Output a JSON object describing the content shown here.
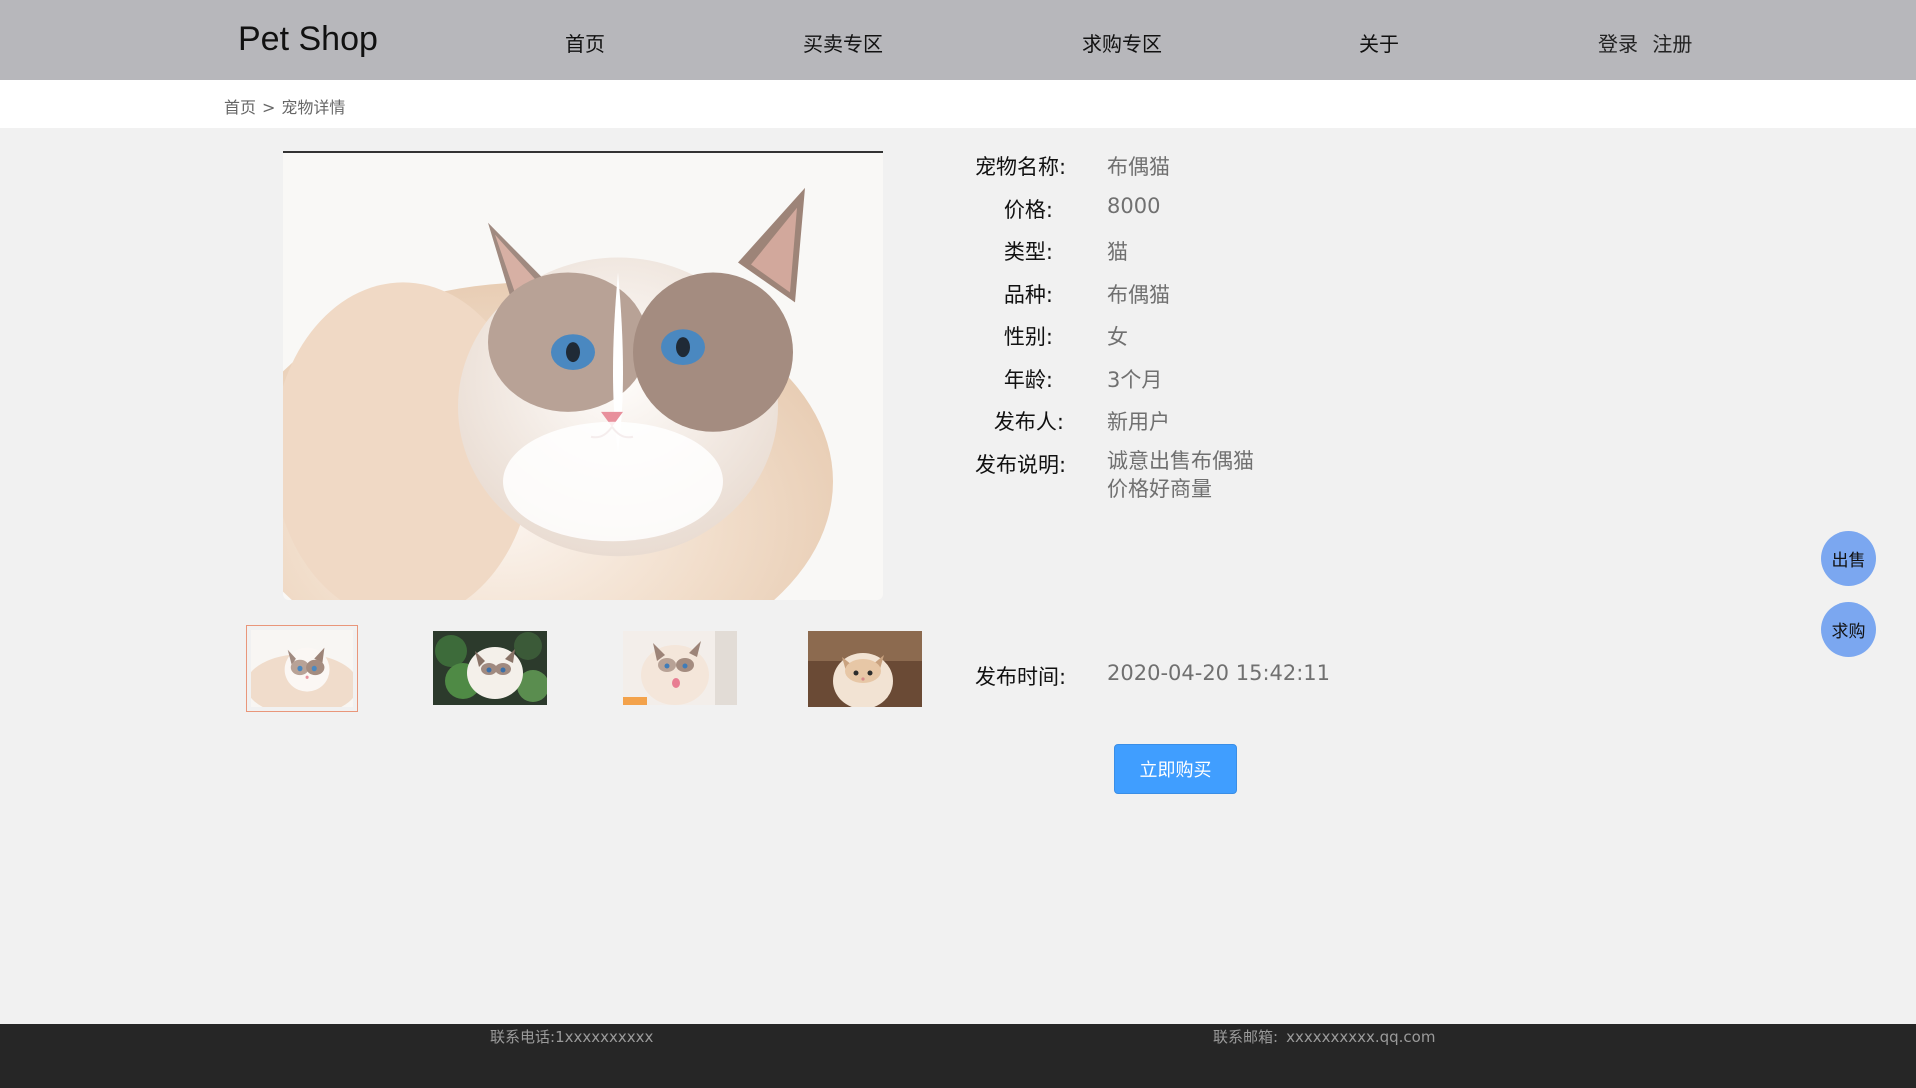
{
  "header": {
    "brand": "Pet Shop",
    "nav": [
      "首页",
      "买卖专区",
      "求购专区",
      "关于"
    ],
    "login": "登录",
    "register": "注册"
  },
  "breadcrumb": {
    "home": "首页",
    "separator": ">",
    "current": "宠物详情"
  },
  "pet": {
    "name_label": "宠物名称:",
    "name": "布偶猫",
    "price_label": "价格:",
    "price": "8000",
    "type_label": "类型:",
    "type": "猫",
    "breed_label": "品种:",
    "breed": "布偶猫",
    "gender_label": "性别:",
    "gender": "女",
    "age_label": "年龄:",
    "age": "3个月",
    "publisher_label": "发布人:",
    "publisher": "新用户",
    "desc_label": "发布说明:",
    "desc_lines": [
      "诚意出售布偶猫",
      "价格好商量"
    ],
    "time_label": "发布时间:",
    "time": "2020-04-20 15:42:11"
  },
  "actions": {
    "buy": "立即购买"
  },
  "floating": {
    "sell": "出售",
    "want": "求购"
  },
  "footer": {
    "phone_label": "联系电话:",
    "phone": "1xxxxxxxxxx",
    "email_label": "联系邮箱:",
    "email": "xxxxxxxxxx.qq.com"
  },
  "colors": {
    "header_bg": "#b7b7bb",
    "accent_blue": "#409eff",
    "float_btn": "#7ba7f0",
    "footer_bg": "#262626",
    "thumb_active_border": "#e9967a"
  }
}
